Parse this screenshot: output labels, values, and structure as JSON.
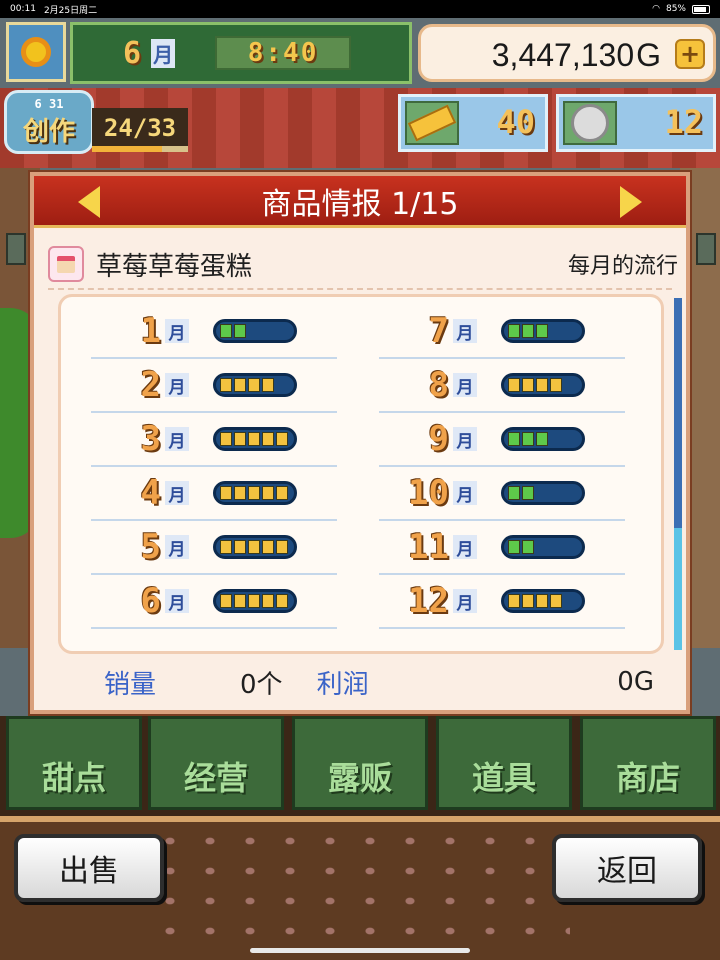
{
  "status_bar": {
    "time": "00:11",
    "date": "2月25日周二",
    "battery": "85%"
  },
  "hud": {
    "month_num": "6",
    "month_char": "月",
    "time": "8:40",
    "money": "3,447,130",
    "money_unit": "G",
    "plus_label": "+",
    "create": {
      "date": "6 31",
      "label": "创作",
      "count": "24/33",
      "progress": 0.73
    },
    "tickets": "40",
    "medals": "12"
  },
  "dialog": {
    "title": "商品情报 1/15",
    "item_name": "草莓草莓蛋糕",
    "trend_label": "每月的流行",
    "month_char": "月",
    "months": [
      {
        "month": "1",
        "level": 2,
        "color": "green"
      },
      {
        "month": "2",
        "level": 4,
        "color": "yellow"
      },
      {
        "month": "3",
        "level": 5,
        "color": "yellow"
      },
      {
        "month": "4",
        "level": 5,
        "color": "yellow"
      },
      {
        "month": "5",
        "level": 5,
        "color": "yellow"
      },
      {
        "month": "6",
        "level": 5,
        "color": "yellow"
      },
      {
        "month": "7",
        "level": 3,
        "color": "green"
      },
      {
        "month": "8",
        "level": 4,
        "color": "yellow"
      },
      {
        "month": "9",
        "level": 3,
        "color": "green"
      },
      {
        "month": "10",
        "level": 2,
        "color": "green"
      },
      {
        "month": "11",
        "level": 2,
        "color": "green"
      },
      {
        "month": "12",
        "level": 4,
        "color": "yellow"
      }
    ],
    "sales_label": "销量",
    "sales_value": "0个",
    "profit_label": "利润",
    "profit_value": "0G"
  },
  "menu": {
    "tabs": [
      "甜点",
      "经营",
      "露贩",
      "道具",
      "商店"
    ]
  },
  "buttons": {
    "sell": "出售",
    "back": "返回"
  }
}
